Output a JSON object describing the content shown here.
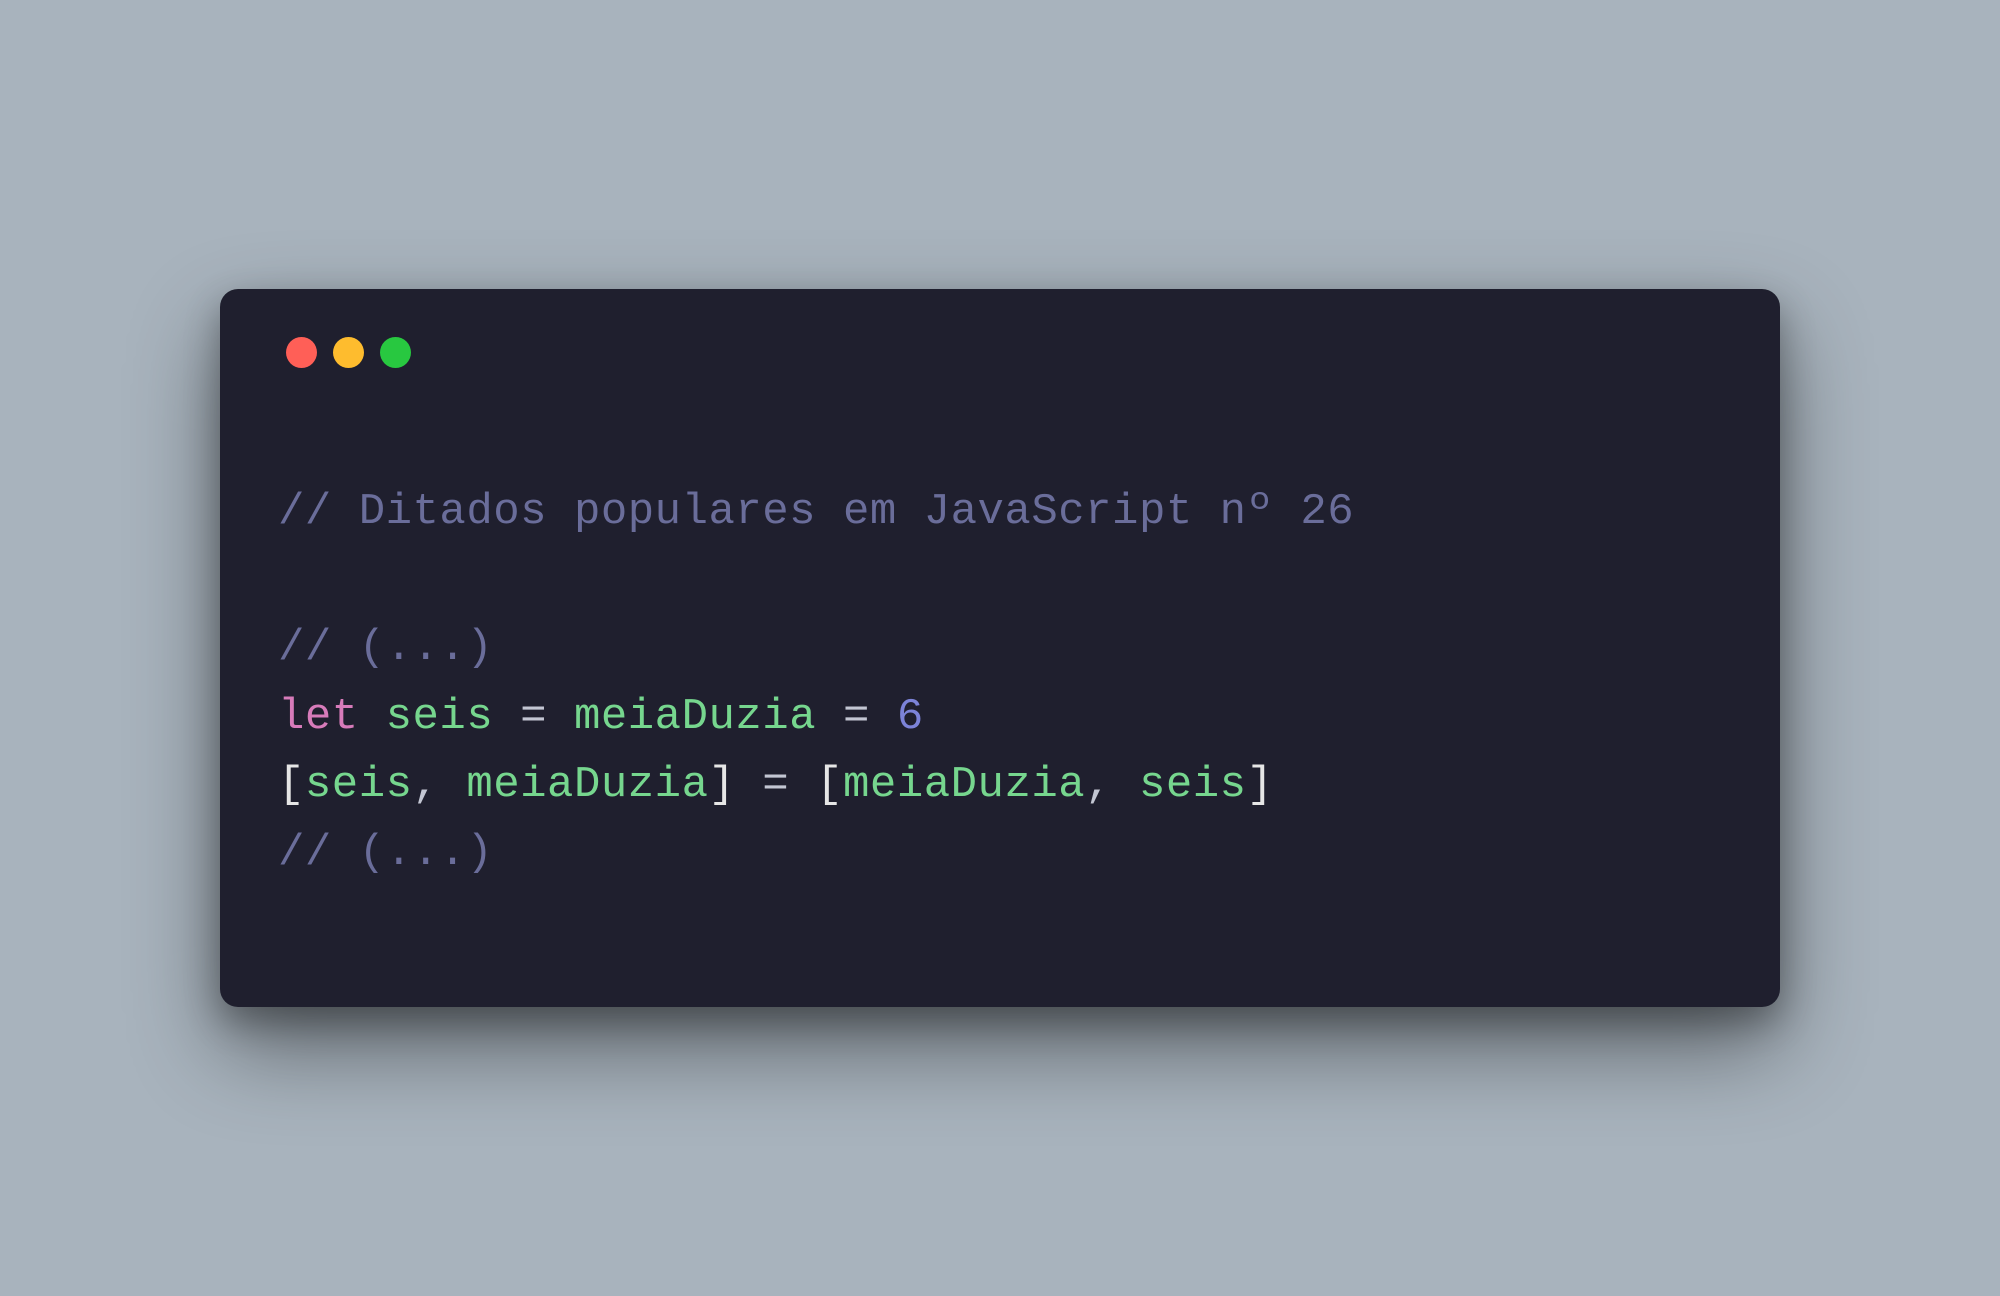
{
  "window": {
    "traffic_colors": {
      "close": "#ff5f57",
      "minimize": "#febc2e",
      "zoom": "#28c840"
    }
  },
  "code": {
    "line1_comment": "// Ditados populares em JavaScript nº 26",
    "blank": "",
    "line2_comment": "// (...)",
    "line3": {
      "let": "let",
      "sp1": " ",
      "seis": "seis",
      "sp2": " ",
      "eq1": "=",
      "sp3": " ",
      "meiaDuzia": "meiaDuzia",
      "sp4": " ",
      "eq2": "=",
      "sp5": " ",
      "six": "6"
    },
    "line4": {
      "lb1": "[",
      "seis": "seis",
      "comma1": ",",
      "sp1": " ",
      "meiaDuzia": "meiaDuzia",
      "rb1": "]",
      "sp2": " ",
      "eq": "=",
      "sp3": " ",
      "lb2": "[",
      "meiaDuzia2": "meiaDuzia",
      "comma2": ",",
      "sp4": " ",
      "seis2": "seis",
      "rb2": "]"
    },
    "line5_comment": "// (...)"
  }
}
